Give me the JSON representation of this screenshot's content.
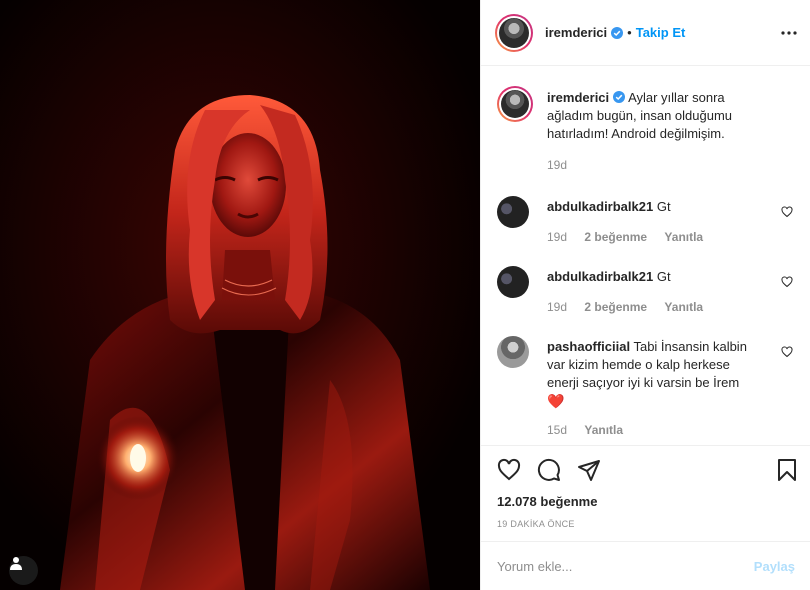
{
  "header": {
    "username": "iremderici",
    "dot": "•",
    "follow_label": "Takip Et"
  },
  "caption": {
    "username": "iremderici",
    "text": "Aylar yıllar sonra ağladım bugün, insan olduğumu hatırladım! Android değilmişim.",
    "age": "19d"
  },
  "comments": [
    {
      "username": "abdulkadirbalk21",
      "text": "Gt",
      "age": "19d",
      "likes": "2 beğenme",
      "reply": "Yanıtla"
    },
    {
      "username": "abdulkadirbalk21",
      "text": "Gt",
      "age": "19d",
      "likes": "2 beğenme",
      "reply": "Yanıtla"
    },
    {
      "username": "pashaofficiial",
      "text": "Tabi İnsansin kalbin var kizim hemde o kalp herkese enerji saçıyor iyi ki varsin be İrem",
      "emoji": "❤️",
      "age": "15d",
      "reply": "Yanıtla"
    }
  ],
  "actions": {
    "likes": "12.078 beğenme",
    "time": "19 DAKİKA ÖNCE"
  },
  "add_comment": {
    "placeholder": "Yorum ekle...",
    "post_label": "Paylaş"
  },
  "colors": {
    "accent": "#0095f6",
    "verified": "#3897f0",
    "heart_red": "#ed4956",
    "photo_red": "#c0201a"
  },
  "icons": [
    "user-tag-icon",
    "verified-badge-icon",
    "more-options-icon",
    "heart-icon",
    "comment-icon",
    "share-icon",
    "bookmark-icon"
  ]
}
